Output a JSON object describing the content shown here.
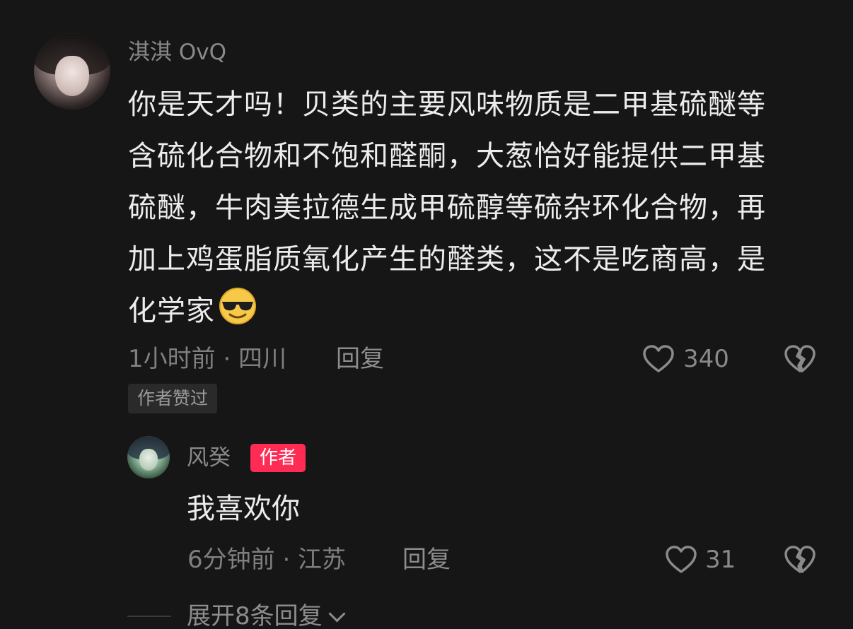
{
  "comment": {
    "username": "淇淇 OvQ",
    "lines": [
      "你是天才吗！贝类的主要风味物质是二甲基硫醚等",
      "含硫化合物和不饱和醛酮，大葱恰好能提供二甲基",
      "硫醚，牛肉美拉德生成甲硫醇等硫杂环化合物，再",
      "加上鸡蛋脂质氧化产生的醛类，这不是吃商高，是",
      "化学家"
    ],
    "emoji_icon": "sunglasses-face-emoji",
    "meta": "1小时前 · 四川",
    "reply_label": "回复",
    "like_count": "340",
    "liked_by_author_tag": "作者赞过"
  },
  "reply": {
    "username": "风癸",
    "author_badge": "作者",
    "text": "我喜欢你",
    "meta": "6分钟前 · 江苏",
    "reply_label": "回复",
    "like_count": "31"
  },
  "expand": {
    "label": "展开8条回复"
  },
  "colors": {
    "background": "#161616",
    "text_primary": "#ececec",
    "text_secondary": "#8a8a8a",
    "author_badge": "#fe2c55"
  }
}
